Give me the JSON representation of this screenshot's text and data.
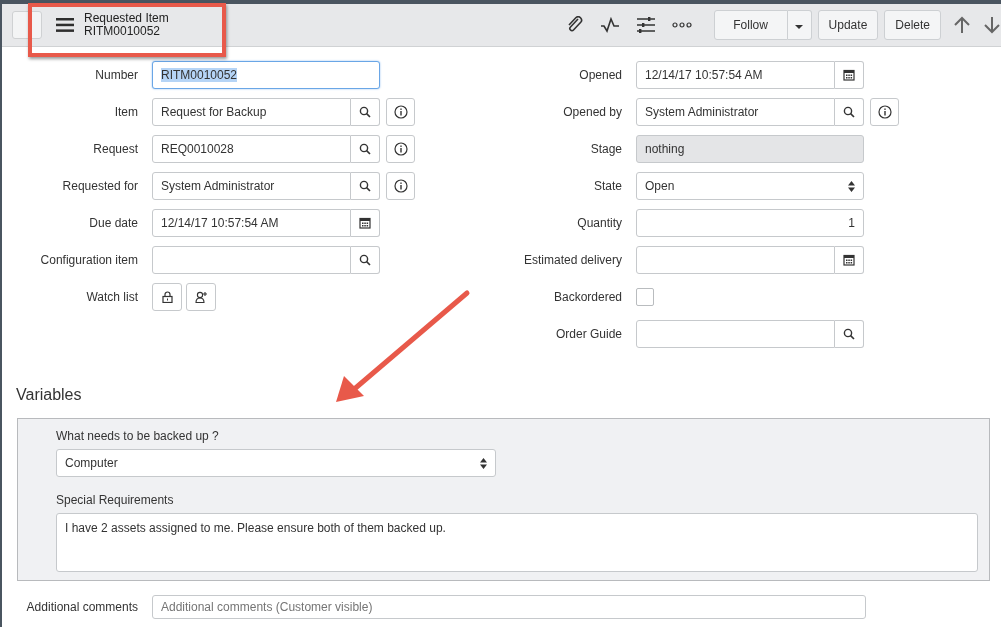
{
  "header": {
    "title": "Requested Item",
    "subtitle": "RITM0010052",
    "buttons": [
      {
        "label": "Follow",
        "kind": "split"
      },
      {
        "label": "Update",
        "kind": "plain"
      },
      {
        "label": "Delete",
        "kind": "plain"
      }
    ]
  },
  "left_fields": [
    {
      "label": "Number",
      "kind": "text",
      "value": "RITM0010052",
      "focused": true
    },
    {
      "label": "Item",
      "kind": "text",
      "value": "Request for Backup",
      "focused": false,
      "buttons": [
        {
          "kind": "search"
        },
        {
          "kind": "info"
        }
      ]
    },
    {
      "label": "Request",
      "kind": "text",
      "value": "REQ0010028",
      "focused": false,
      "buttons": [
        {
          "kind": "search"
        },
        {
          "kind": "info"
        }
      ]
    },
    {
      "label": "Requested for",
      "kind": "text",
      "value": "System Administrator",
      "focused": false,
      "buttons": [
        {
          "kind": "search"
        },
        {
          "kind": "info"
        }
      ]
    },
    {
      "label": "Due date",
      "kind": "text",
      "value": "12/14/17 10:57:54 AM",
      "focused": false,
      "buttons": [
        {
          "kind": "calendar"
        }
      ]
    },
    {
      "label": "Configuration item",
      "kind": "text",
      "focused": false,
      "buttons": [
        {
          "kind": "search"
        }
      ]
    },
    {
      "label": "Watch list",
      "kind": "watchlist"
    }
  ],
  "right_fields": [
    {
      "label": "Opened",
      "kind": "text",
      "value": "12/14/17 10:57:54 AM",
      "focused": false,
      "buttons": [
        {
          "kind": "calendar"
        }
      ]
    },
    {
      "label": "Opened by",
      "kind": "text",
      "value": "System Administrator",
      "focused": false,
      "buttons": [
        {
          "kind": "search"
        },
        {
          "kind": "info"
        }
      ]
    },
    {
      "label": "Stage",
      "kind": "readonly",
      "value": "nothing"
    },
    {
      "label": "State",
      "kind": "select",
      "value": "Open"
    },
    {
      "label": "Quantity",
      "kind": "number",
      "value": "1",
      "focused": false
    },
    {
      "label": "Estimated delivery",
      "kind": "text",
      "focused": false,
      "buttons": [
        {
          "kind": "calendar"
        }
      ]
    },
    {
      "label": "Backordered",
      "kind": "checkbox",
      "checked": false
    },
    {
      "label": "Order Guide",
      "kind": "text",
      "focused": false,
      "buttons": [
        {
          "kind": "search"
        }
      ]
    }
  ],
  "variables": {
    "heading": "Variables",
    "items": [
      {
        "label": "What needs to be backed up ?",
        "kind": "select",
        "value": "Computer"
      },
      {
        "label": "Special Requirements",
        "kind": "textarea",
        "value": "I have 2 assets assigned to me. Please ensure both of them backed up."
      }
    ]
  },
  "additional_comments": {
    "label": "Additional comments",
    "placeholder": "Additional comments (Customer visible)"
  }
}
